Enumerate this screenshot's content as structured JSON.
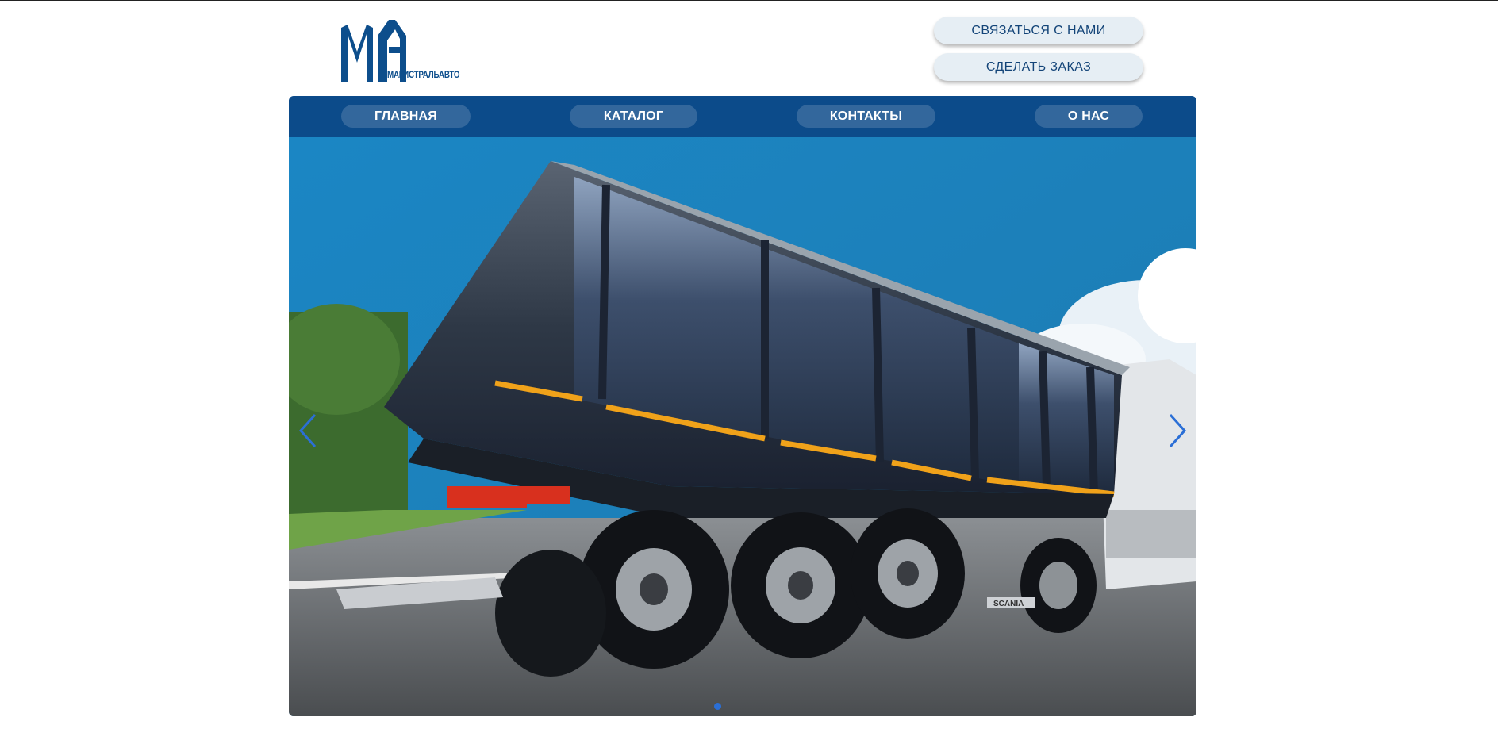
{
  "brand": {
    "logo_text": "МАГИСТРАЛЬАВТО",
    "logo_icon": "ma-monogram-logo",
    "brand_color": "#0d4e8c"
  },
  "header": {
    "contact_label": "СВЯЗАТЬСЯ С НАМИ",
    "order_label": "СДЕЛАТЬ ЗАКАЗ"
  },
  "nav": {
    "items": [
      {
        "label": "ГЛАВНАЯ"
      },
      {
        "label": "КАТАЛОГ"
      },
      {
        "label": "КОНТАКТЫ"
      },
      {
        "label": "О НАС"
      }
    ],
    "background": "#0c4b8a"
  },
  "slider": {
    "image": "dump-semi-trailer-photo",
    "prev_icon": "chevron-left-icon",
    "next_icon": "chevron-right-icon",
    "dots_total": 1,
    "active_dot": 1,
    "arrow_color": "#2b6fd6",
    "brand_label": "SCANIA"
  }
}
